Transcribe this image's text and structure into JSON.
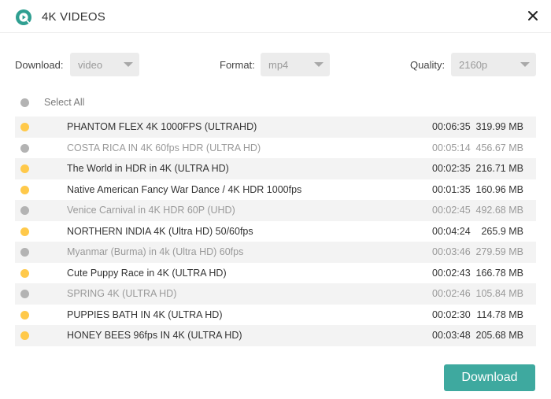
{
  "window": {
    "title": "4K VIDEOS"
  },
  "options": {
    "download_label": "Download:",
    "download_value": "video",
    "format_label": "Format:",
    "format_value": "mp4",
    "quality_label": "Quality:",
    "quality_value": "2160p"
  },
  "select_all_label": "Select All",
  "videos": [
    {
      "title": "PHANTOM FLEX 4K 1000FPS (ULTRAHD)",
      "duration": "00:06:35",
      "size": "319.99 MB",
      "selected": true
    },
    {
      "title": "COSTA RICA IN 4K 60fps HDR (ULTRA HD)",
      "duration": "00:05:14",
      "size": "456.67 MB",
      "selected": false
    },
    {
      "title": "The World in HDR in 4K (ULTRA HD)",
      "duration": "00:02:35",
      "size": "216.71 MB",
      "selected": true
    },
    {
      "title": "Native American Fancy War Dance / 4K HDR 1000fps",
      "duration": "00:01:35",
      "size": "160.96 MB",
      "selected": true
    },
    {
      "title": "Venice Carnival in 4K HDR 60P (UHD)",
      "duration": "00:02:45",
      "size": "492.68 MB",
      "selected": false
    },
    {
      "title": "NORTHERN INDIA 4K (Ultra HD) 50/60fps",
      "duration": "00:04:24",
      "size": "265.9 MB",
      "selected": true
    },
    {
      "title": "Myanmar (Burma) in 4k (Ultra HD) 60fps",
      "duration": "00:03:46",
      "size": "279.59 MB",
      "selected": false
    },
    {
      "title": "Cute Puppy Race in 4K (ULTRA HD)",
      "duration": "00:02:43",
      "size": "166.78 MB",
      "selected": true
    },
    {
      "title": "SPRING 4K (ULTRA HD)",
      "duration": "00:02:46",
      "size": "105.84 MB",
      "selected": false
    },
    {
      "title": "PUPPIES BATH IN 4K (ULTRA HD)",
      "duration": "00:02:30",
      "size": "114.78 MB",
      "selected": true
    },
    {
      "title": "HONEY BEES 96fps IN 4K (ULTRA HD)",
      "duration": "00:03:48",
      "size": "205.68 MB",
      "selected": true
    }
  ],
  "download_button_label": "Download",
  "colors": {
    "accent": "#3ea99f",
    "selected_dot": "#ffc94a",
    "unselected_dot": "#b3b3b3"
  },
  "icons": {
    "app": "app-logo-icon",
    "close": "close-icon",
    "dropdown": "chevron-down-icon"
  }
}
